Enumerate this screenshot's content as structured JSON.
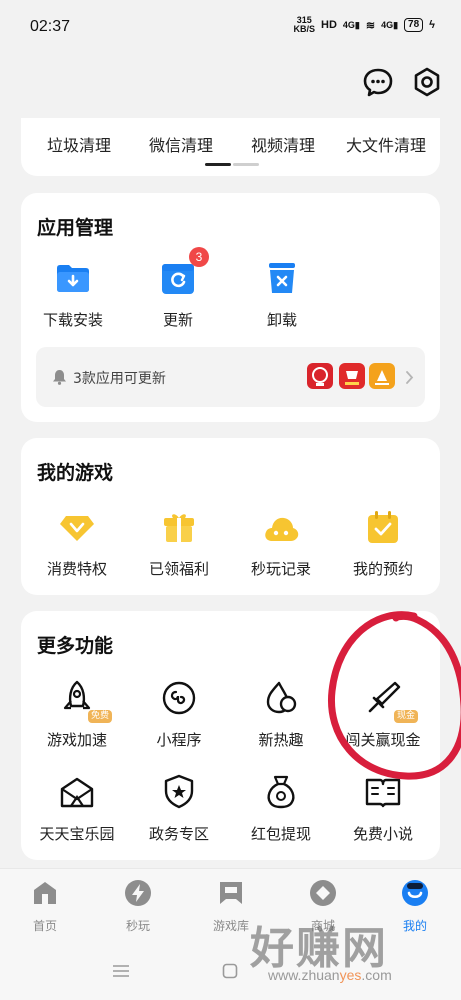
{
  "status_bar": {
    "time": "02:37",
    "speed_value": "315",
    "speed_unit": "KB/S",
    "hd": "HD",
    "net1": "4G",
    "net2": "4G",
    "battery": "78"
  },
  "clean": {
    "tabs": [
      "垃圾清理",
      "微信清理",
      "视频清理",
      "大文件清理"
    ]
  },
  "app_manage": {
    "title": "应用管理",
    "items": [
      {
        "label": "下载安装",
        "icon": "download-folder-icon"
      },
      {
        "label": "更新",
        "icon": "update-icon",
        "badge": "3"
      },
      {
        "label": "卸载",
        "icon": "uninstall-icon"
      }
    ],
    "update_text": "3款应用可更新"
  },
  "my_games": {
    "title": "我的游戏",
    "items": [
      {
        "label": "消费特权",
        "icon": "diamond-icon"
      },
      {
        "label": "已领福利",
        "icon": "gift-icon"
      },
      {
        "label": "秒玩记录",
        "icon": "cloud-game-icon"
      },
      {
        "label": "我的预约",
        "icon": "calendar-check-icon"
      }
    ]
  },
  "more": {
    "title": "更多功能",
    "items": [
      {
        "label": "游戏加速",
        "icon": "rocket-icon",
        "tag": "免费"
      },
      {
        "label": "小程序",
        "icon": "mini-program-icon"
      },
      {
        "label": "新热趣",
        "icon": "flame-icon"
      },
      {
        "label": "闯关赢现金",
        "icon": "sword-icon",
        "tag": "现金"
      },
      {
        "label": "天天宝乐园",
        "icon": "treasure-tent-icon"
      },
      {
        "label": "政务专区",
        "icon": "shield-star-icon"
      },
      {
        "label": "红包提现",
        "icon": "money-bag-icon"
      },
      {
        "label": "免费小说",
        "icon": "book-icon"
      }
    ]
  },
  "bottom_nav": {
    "items": [
      {
        "label": "首页",
        "icon": "home-icon"
      },
      {
        "label": "秒玩",
        "icon": "lightning-icon"
      },
      {
        "label": "游戏库",
        "icon": "game-library-icon"
      },
      {
        "label": "商城",
        "icon": "store-icon"
      },
      {
        "label": "我的",
        "icon": "profile-icon",
        "active": true
      }
    ]
  },
  "watermark": {
    "main": "好赚网",
    "url_prefix": "www.zhuan",
    "url_accent": "yes",
    "url_suffix": ".com"
  },
  "colors": {
    "accent_blue": "#1a7ff2",
    "game_yellow": "#f7c531",
    "badge_red": "#f04848",
    "tag_orange": "#f0b457",
    "nav_gray": "#8a8a8a",
    "annotation_red": "#d81e3c"
  }
}
